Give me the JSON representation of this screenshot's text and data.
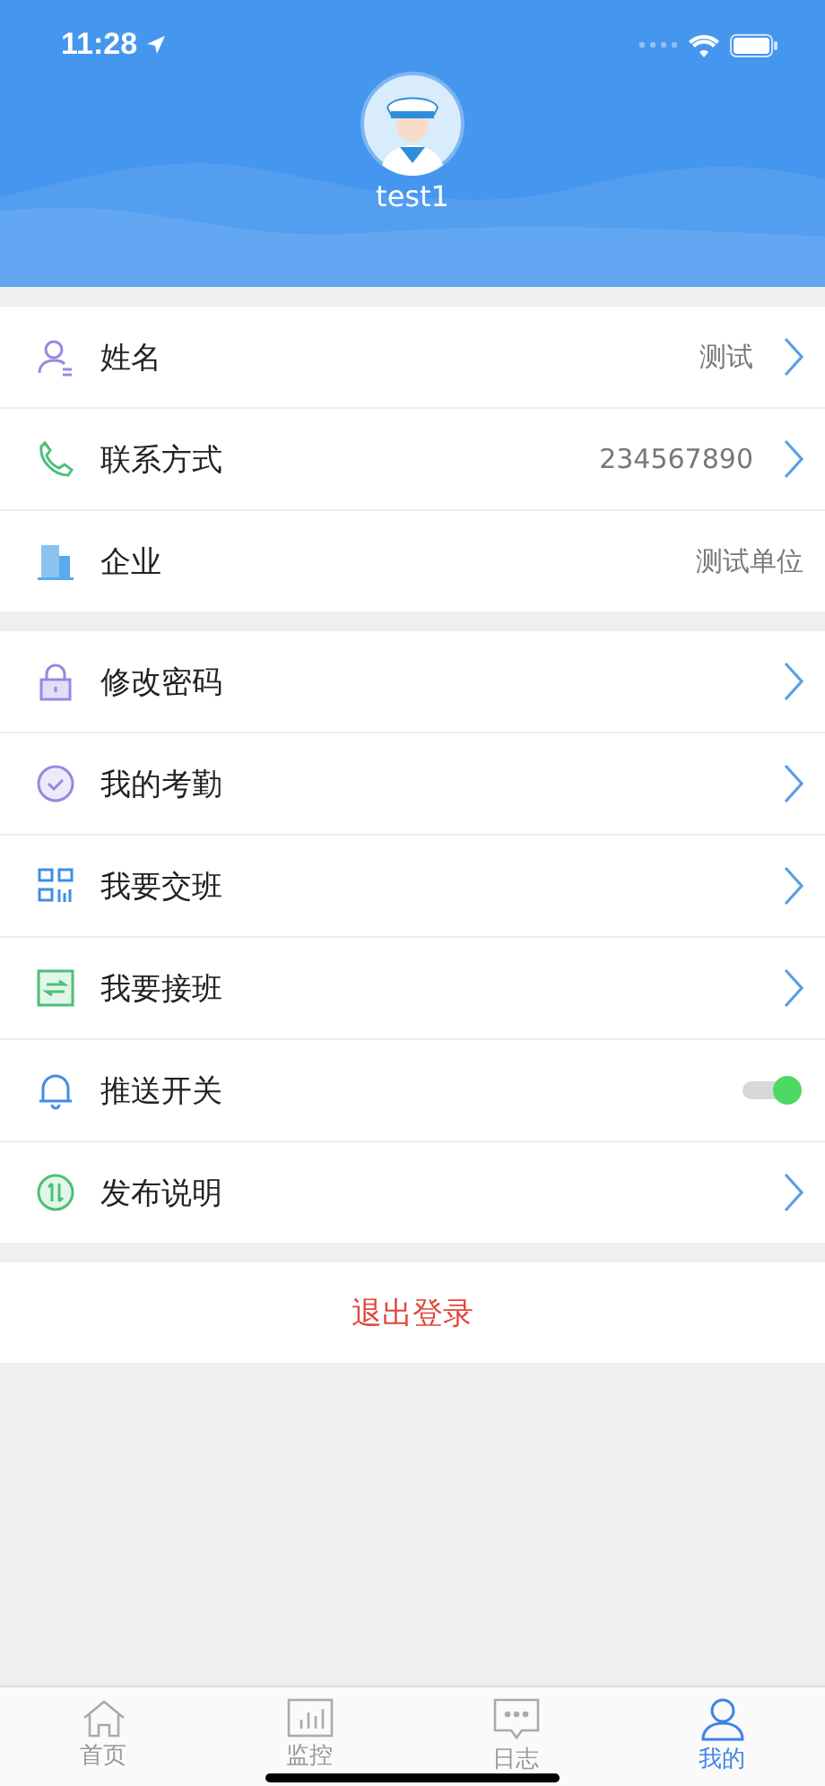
{
  "status_bar": {
    "time": "11:28"
  },
  "profile": {
    "username": "test1"
  },
  "sections": [
    {
      "rows": [
        {
          "kind": "link",
          "label": "姓名",
          "value": "测试"
        },
        {
          "kind": "link",
          "label": "联系方式",
          "value": "234567890"
        },
        {
          "kind": "info",
          "label": "企业",
          "value": "测试单位"
        }
      ]
    },
    {
      "rows": [
        {
          "kind": "link",
          "label": "修改密码"
        },
        {
          "kind": "link",
          "label": "我的考勤"
        },
        {
          "kind": "link",
          "label": "我要交班"
        },
        {
          "kind": "link",
          "label": "我要接班"
        },
        {
          "kind": "toggle",
          "label": "推送开关",
          "on": true
        },
        {
          "kind": "link",
          "label": "发布说明"
        }
      ]
    }
  ],
  "logout_button": "退出登录",
  "tab_bar": [
    {
      "label": "首页",
      "selected": false
    },
    {
      "label": "监控",
      "selected": false
    },
    {
      "label": "日志",
      "selected": false
    },
    {
      "label": "我的",
      "selected": true
    }
  ]
}
